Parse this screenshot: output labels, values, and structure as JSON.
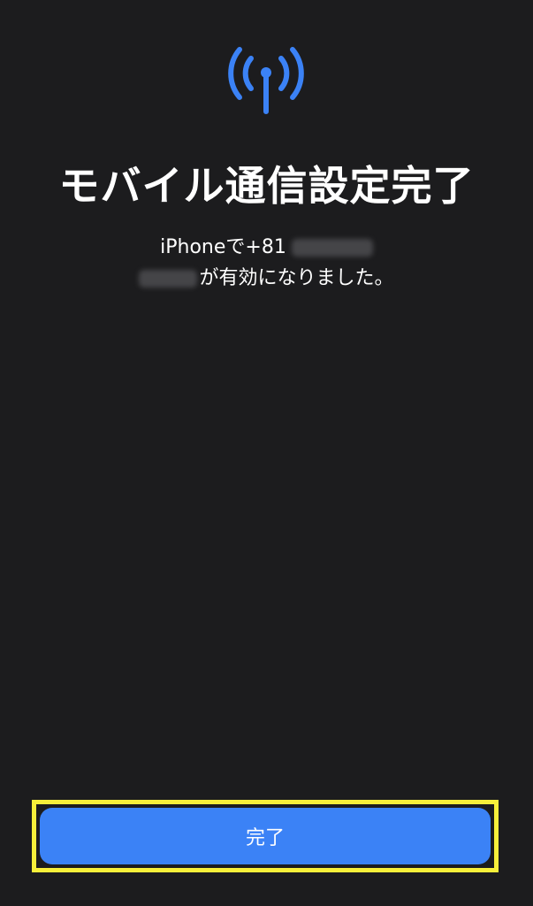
{
  "screen": {
    "title": "モバイル通信設定完了",
    "description_line1_prefix": "iPhoneで+81",
    "description_line2_suffix": "が有効になりました。",
    "icon": "antenna-signal-icon",
    "accent_color": "#3b82f6",
    "background_color": "#1c1c1e"
  },
  "actions": {
    "done_label": "完了",
    "highlight_color": "#f7ef3a"
  }
}
